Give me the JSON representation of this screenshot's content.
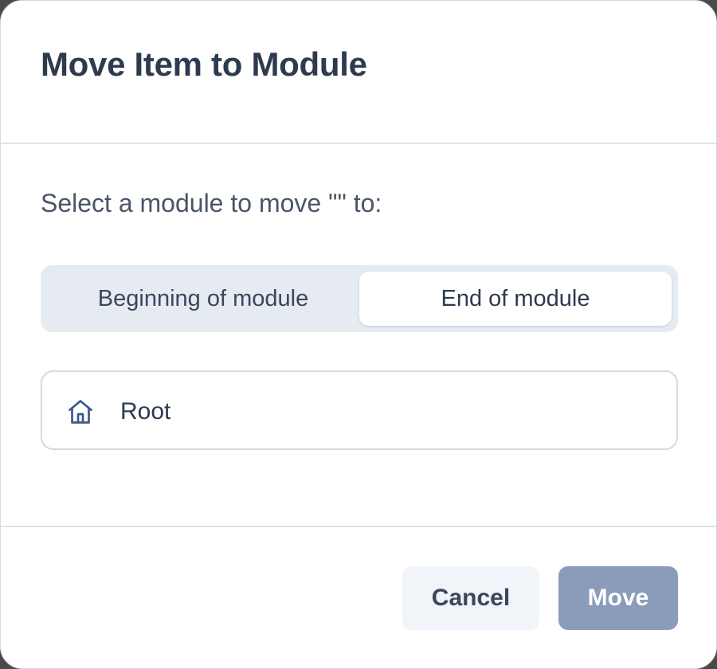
{
  "dialog": {
    "title": "Move Item to Module",
    "prompt": "Select a module to move \"\" to:"
  },
  "position_toggle": {
    "options": [
      {
        "label": "Beginning of module",
        "selected": false
      },
      {
        "label": "End of module",
        "selected": true
      }
    ]
  },
  "modules": [
    {
      "label": "Root",
      "icon": "house-icon"
    }
  ],
  "footer": {
    "cancel_label": "Cancel",
    "move_label": "Move"
  },
  "colors": {
    "title_text": "#2d3a4f",
    "segment_track": "#e6ebf2",
    "move_button": "#8b9bba",
    "cancel_button": "#f1f4f8",
    "icon_stroke": "#3d5a8a"
  }
}
